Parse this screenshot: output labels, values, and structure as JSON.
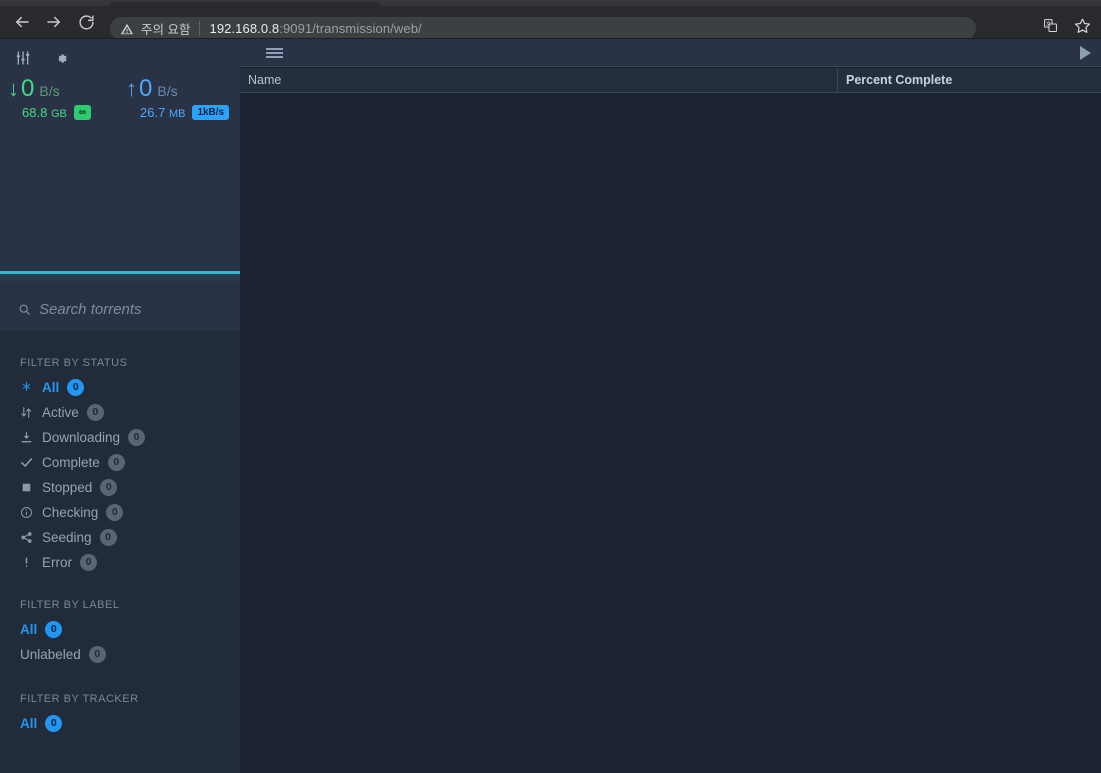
{
  "browser": {
    "nav": {
      "back_icon": "arrow-left-icon",
      "forward_icon": "arrow-right-icon",
      "reload_icon": "reload-icon"
    },
    "security_warning": "주의 요함",
    "security_icon": "warning-triangle-icon",
    "url_host": "192.168.0.8",
    "url_rest": ":9091/transmission/web/",
    "url_full": "192.168.0.8:9091/transmission/web/",
    "translate_icon": "translate-icon",
    "bookmark_icon": "star-icon"
  },
  "app": {
    "toolbar_icons": [
      {
        "name": "tune-sliders-icon",
        "glyph": "sliders"
      },
      {
        "name": "gear-settings-icon",
        "glyph": "gear"
      }
    ],
    "speeds": {
      "download": {
        "arrow": "↓",
        "rate": "0",
        "rate_unit": "B/s",
        "total": "68.8",
        "total_unit": "GB",
        "limit_badge": "∞",
        "color": "#3ddc84"
      },
      "upload": {
        "arrow": "↑",
        "rate": "0",
        "rate_unit": "B/s",
        "total": "26.7",
        "total_unit": "MB",
        "limit_badge": "1kB/s",
        "color": "#4aa8ff"
      }
    },
    "search": {
      "icon": "search-icon",
      "placeholder": "Search torrents",
      "value": ""
    },
    "filter_status": {
      "title": "FILTER BY STATUS",
      "items": [
        {
          "icon": "asterisk-icon",
          "glyph": "✳",
          "label": "All",
          "count": "0",
          "selected": true
        },
        {
          "icon": "transfer-arrows-icon",
          "glyph": "⇅",
          "label": "Active",
          "count": "0",
          "selected": false
        },
        {
          "icon": "download-icon",
          "glyph": "⤓",
          "label": "Downloading",
          "count": "0",
          "selected": false
        },
        {
          "icon": "check-icon",
          "glyph": "✔",
          "label": "Complete",
          "count": "0",
          "selected": false
        },
        {
          "icon": "stop-square-icon",
          "glyph": "■",
          "label": "Stopped",
          "count": "0",
          "selected": false
        },
        {
          "icon": "info-circle-icon",
          "glyph": "ⓘ",
          "label": "Checking",
          "count": "0",
          "selected": false
        },
        {
          "icon": "share-nodes-icon",
          "glyph": "⤳",
          "label": "Seeding",
          "count": "0",
          "selected": false
        },
        {
          "icon": "exclamation-icon",
          "glyph": "!",
          "label": "Error",
          "count": "0",
          "selected": false
        }
      ]
    },
    "filter_label": {
      "title": "FILTER BY LABEL",
      "items": [
        {
          "label": "All",
          "count": "0",
          "selected": true
        },
        {
          "label": "Unlabeled",
          "count": "0",
          "selected": false
        }
      ]
    },
    "filter_tracker": {
      "title": "FILTER BY TRACKER",
      "items": [
        {
          "label": "All",
          "count": "0",
          "selected": true
        }
      ]
    },
    "main_toolbar": {
      "menu_icon": "hamburger-menu-icon",
      "play_icon": "play-triangle-icon"
    },
    "table": {
      "columns": [
        {
          "label": "Name",
          "sorted": false
        },
        {
          "label": "Percent Complete",
          "sorted": true
        }
      ],
      "rows": []
    }
  },
  "colors": {
    "accent_blue": "#2196f3",
    "teal_rule": "#35b8c9",
    "download_green": "#3ddc84",
    "upload_blue": "#4aa8ff",
    "sidebar_bg": "#222b3a",
    "panel_bg": "#1d2431"
  }
}
